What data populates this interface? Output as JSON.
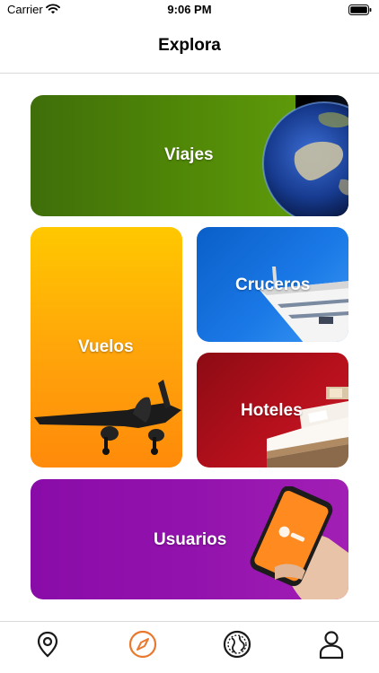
{
  "status_bar": {
    "carrier": "Carrier",
    "time": "9:06 PM"
  },
  "nav": {
    "title": "Explora"
  },
  "cards": {
    "viajes": {
      "label": "Viajes",
      "image": "earth-globe"
    },
    "vuelos": {
      "label": "Vuelos",
      "image": "airplane"
    },
    "cruceros": {
      "label": "Cruceros",
      "image": "cruise-ship"
    },
    "hoteles": {
      "label": "Hoteles",
      "image": "hotel-bed"
    },
    "usuarios": {
      "label": "Usuarios",
      "image": "phone-in-hand"
    }
  },
  "tab_bar": {
    "active_tab": "explore",
    "active_color": "#e8792e",
    "inactive_color": "#1a1a1a",
    "tabs": [
      {
        "id": "map",
        "icon": "location-pin-icon"
      },
      {
        "id": "explore",
        "icon": "compass-icon"
      },
      {
        "id": "world",
        "icon": "globe-icon"
      },
      {
        "id": "profile",
        "icon": "user-icon"
      }
    ]
  }
}
